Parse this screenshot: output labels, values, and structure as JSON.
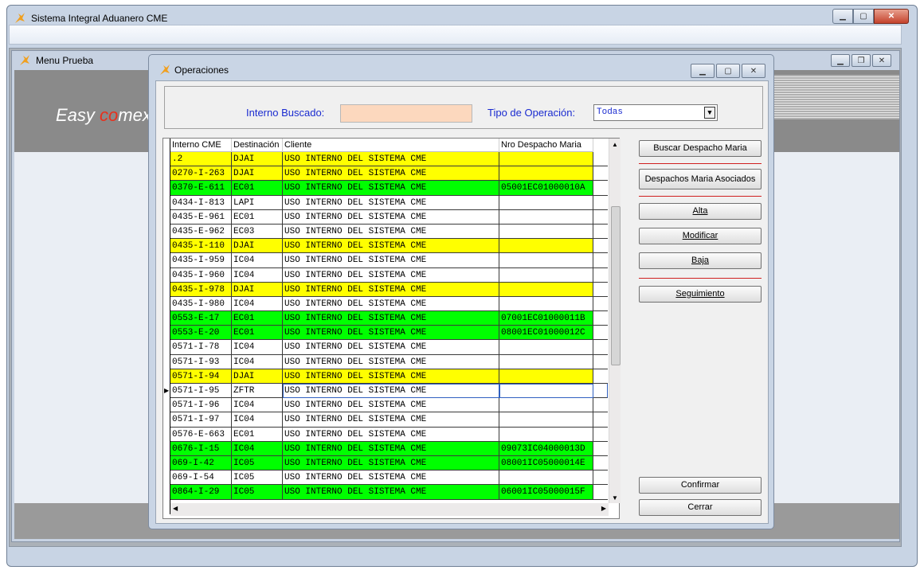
{
  "app": {
    "title": "Sistema Integral Aduanero CME"
  },
  "menu_window": {
    "title": "Menu Prueba",
    "logo": {
      "easy": "Easy ",
      "co": "co",
      "mex": "mex"
    }
  },
  "operaciones": {
    "title": "Operaciones",
    "interno_label": "Interno Buscado:",
    "interno_value": "",
    "tipo_label": "Tipo de Operación:",
    "tipo_value": "Todas"
  },
  "grid": {
    "columns": [
      "Interno CME",
      "Destinación",
      "Cliente",
      "Nro Despacho Maria"
    ],
    "rows": [
      {
        "interno": ".2",
        "dest": "DJAI",
        "cliente": "USO INTERNO DEL SISTEMA CME",
        "despacho": "",
        "color": "yellow"
      },
      {
        "interno": "0270-I-263",
        "dest": "DJAI",
        "cliente": "USO INTERNO DEL SISTEMA CME",
        "despacho": "",
        "color": "yellow"
      },
      {
        "interno": "0370-E-611",
        "dest": "EC01",
        "cliente": "USO INTERNO DEL SISTEMA CME",
        "despacho": "05001EC01000010A",
        "color": "green"
      },
      {
        "interno": "0434-I-813",
        "dest": "LAPI",
        "cliente": "USO INTERNO DEL SISTEMA CME",
        "despacho": "",
        "color": "white"
      },
      {
        "interno": "0435-E-961",
        "dest": "EC01",
        "cliente": "USO INTERNO DEL SISTEMA CME",
        "despacho": "",
        "color": "white"
      },
      {
        "interno": "0435-E-962",
        "dest": "EC03",
        "cliente": "USO INTERNO DEL SISTEMA CME",
        "despacho": "",
        "color": "white"
      },
      {
        "interno": "0435-I-110",
        "dest": "DJAI",
        "cliente": "USO INTERNO DEL SISTEMA CME",
        "despacho": "",
        "color": "yellow"
      },
      {
        "interno": "0435-I-959",
        "dest": "IC04",
        "cliente": "USO INTERNO DEL SISTEMA CME",
        "despacho": "",
        "color": "white"
      },
      {
        "interno": "0435-I-960",
        "dest": "IC04",
        "cliente": "USO INTERNO DEL SISTEMA CME",
        "despacho": "",
        "color": "white"
      },
      {
        "interno": "0435-I-978",
        "dest": "DJAI",
        "cliente": "USO INTERNO DEL SISTEMA CME",
        "despacho": "",
        "color": "yellow"
      },
      {
        "interno": "0435-I-980",
        "dest": "IC04",
        "cliente": "USO INTERNO DEL SISTEMA CME",
        "despacho": "",
        "color": "white"
      },
      {
        "interno": "0553-E-17",
        "dest": "EC01",
        "cliente": "USO INTERNO DEL SISTEMA CME",
        "despacho": "07001EC01000011B",
        "color": "green"
      },
      {
        "interno": "0553-E-20",
        "dest": "EC01",
        "cliente": "USO INTERNO DEL SISTEMA CME",
        "despacho": "08001EC01000012C",
        "color": "green"
      },
      {
        "interno": "0571-I-78",
        "dest": "IC04",
        "cliente": "USO INTERNO DEL SISTEMA CME",
        "despacho": "",
        "color": "white"
      },
      {
        "interno": "0571-I-93",
        "dest": "IC04",
        "cliente": "USO INTERNO DEL SISTEMA CME",
        "despacho": "",
        "color": "white"
      },
      {
        "interno": "0571-I-94",
        "dest": "DJAI",
        "cliente": "USO INTERNO DEL SISTEMA CME",
        "despacho": "",
        "color": "yellow"
      },
      {
        "interno": "0571-I-95",
        "dest": "ZFTR",
        "cliente": "USO INTERNO DEL SISTEMA CME",
        "despacho": "",
        "color": "white",
        "selected": true
      },
      {
        "interno": "0571-I-96",
        "dest": "IC04",
        "cliente": "USO INTERNO DEL SISTEMA CME",
        "despacho": "",
        "color": "white"
      },
      {
        "interno": "0571-I-97",
        "dest": "IC04",
        "cliente": "USO INTERNO DEL SISTEMA CME",
        "despacho": "",
        "color": "white"
      },
      {
        "interno": "0576-E-663",
        "dest": "EC01",
        "cliente": "USO INTERNO DEL SISTEMA CME",
        "despacho": "",
        "color": "white"
      },
      {
        "interno": "0676-I-15",
        "dest": "IC04",
        "cliente": "USO INTERNO DEL SISTEMA CME",
        "despacho": "09073IC04000013D",
        "color": "green"
      },
      {
        "interno": "069-I-42",
        "dest": "IC05",
        "cliente": "USO INTERNO DEL SISTEMA CME",
        "despacho": "08001IC05000014E",
        "color": "green"
      },
      {
        "interno": "069-I-54",
        "dest": "IC05",
        "cliente": "USO INTERNO DEL SISTEMA CME",
        "despacho": "",
        "color": "white"
      },
      {
        "interno": "0864-I-29",
        "dest": "IC05",
        "cliente": "USO INTERNO DEL SISTEMA CME",
        "despacho": "06001IC05000015F",
        "color": "green"
      }
    ]
  },
  "buttons": {
    "buscar": "Buscar Despacho Maria",
    "asociados": "Despachos Maria Asociados",
    "alta": "Alta",
    "modificar": "Modificar",
    "baja": "Baja",
    "seguimiento": "Seguimiento",
    "confirmar": "Confirmar",
    "cerrar": "Cerrar"
  },
  "colors": {
    "yellow": "#ffff00",
    "green": "#00ff00",
    "white": "#ffffff",
    "label_blue": "#1a2bd0"
  }
}
